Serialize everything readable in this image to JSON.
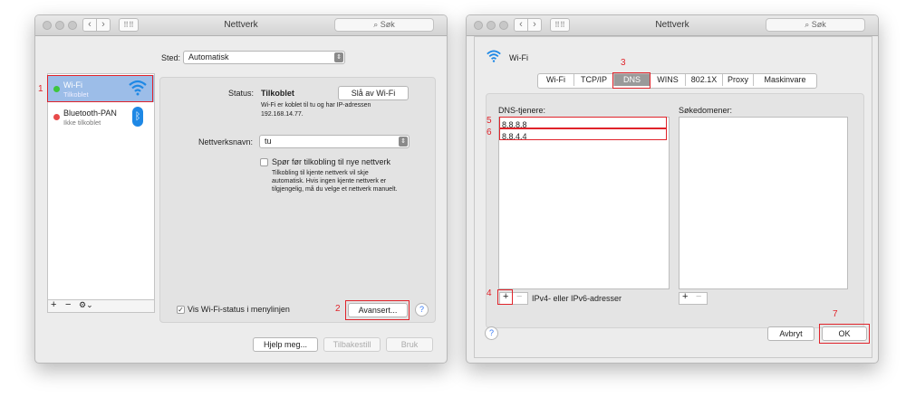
{
  "left_window": {
    "title": "Nettverk",
    "search_placeholder": "Søk",
    "location_label": "Sted:",
    "location_value": "Automatisk",
    "services": [
      {
        "name": "Wi-Fi",
        "status": "Tilkoblet",
        "status_color": "#3dc53d"
      },
      {
        "name": "Bluetooth-PAN",
        "status": "Ikke tilkoblet",
        "status_color": "#e84a4a"
      }
    ],
    "status_label": "Status:",
    "status_value": "Tilkoblet",
    "turn_off_button": "Slå av Wi-Fi",
    "status_desc_1": "Wi-Fi er koblet til tu og har IP-adressen",
    "status_desc_2": "192.168.14.77.",
    "network_name_label": "Nettverksnavn:",
    "network_name_value": "tu",
    "ask_join_label": "Spør før tilkobling til nye nettverk",
    "ask_join_desc_1": "Tilkobling til kjente nettverk vil skje",
    "ask_join_desc_2": "automatisk. Hvis ingen kjente nettverk er",
    "ask_join_desc_3": "tilgjengelig, må du velge et nettverk manuelt.",
    "show_status_label": "Vis Wi-Fi-status i menylinjen",
    "show_status_checked": true,
    "advanced_button": "Avansert...",
    "help_button": "?",
    "help_me_button": "Hjelp meg...",
    "revert_button": "Tilbakestill",
    "apply_button": "Bruk",
    "add_button": "+",
    "remove_button": "−",
    "gear_button": "⚙︎⌄"
  },
  "right_window": {
    "title": "Nettverk",
    "search_placeholder": "Søk",
    "interface_name": "Wi-Fi",
    "tabs": [
      "Wi-Fi",
      "TCP/IP",
      "DNS",
      "WINS",
      "802.1X",
      "Proxy",
      "Maskinvare"
    ],
    "active_tab": "DNS",
    "dns_servers_label": "DNS-tjenere:",
    "dns_servers": [
      "8.8.8.8",
      "8.8.4.4"
    ],
    "search_domains_label": "Søkedomener:",
    "add_button": "+",
    "remove_button": "−",
    "ipv_hint": "IPv4- eller IPv6-adresser",
    "help_button": "?",
    "cancel_button": "Avbryt",
    "ok_button": "OK"
  },
  "annotations": [
    "1",
    "2",
    "3",
    "4",
    "5",
    "6",
    "7"
  ],
  "colors": {
    "annotation_red": "#e0232a",
    "selected_blue": "#9cbde8",
    "wifi_blue": "#1e88e5"
  }
}
